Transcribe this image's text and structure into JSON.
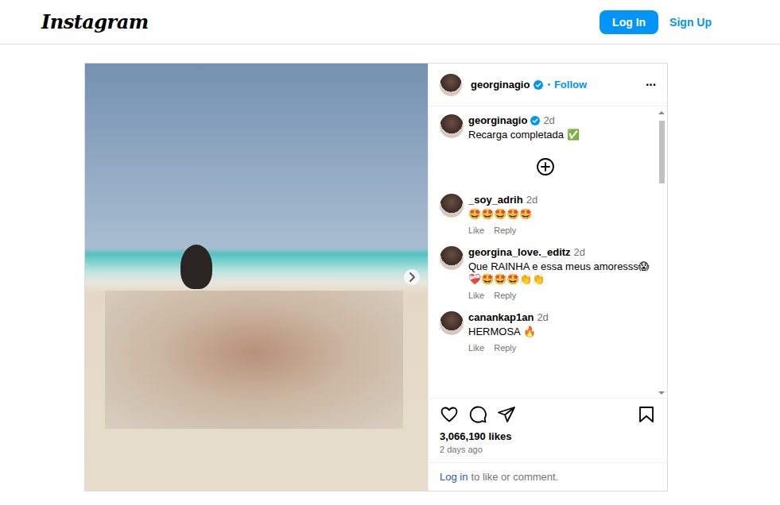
{
  "nav": {
    "logo": "Instagram",
    "login": "Log In",
    "signup": "Sign Up"
  },
  "post": {
    "author": "georginagio",
    "verified": true,
    "separator": "•",
    "follow": "Follow",
    "more": "···",
    "caption": "Recarga completada ✅",
    "time": "2d",
    "likes": "3,066,190 likes",
    "date": "2 days ago"
  },
  "comments": [
    {
      "user": "_soy_adrih",
      "time": "2d",
      "text": "🤩🤩🤩🤩🤩",
      "like": "Like",
      "reply": "Reply"
    },
    {
      "user": "georgina_love._editz",
      "time": "2d",
      "text": "Que RAINHA e essa meus amoresss😱 ❤️‍🩹🤩🤩🤩👏👏",
      "like": "Like",
      "reply": "Reply"
    },
    {
      "user": "canankap1an",
      "time": "2d",
      "text": "HERMOSA 🔥",
      "like": "Like",
      "reply": "Reply"
    }
  ],
  "scrollbar": {
    "offset": 0,
    "visible": 0.24
  },
  "login_prompt": {
    "link": "Log in",
    "text": "to like or comment."
  }
}
